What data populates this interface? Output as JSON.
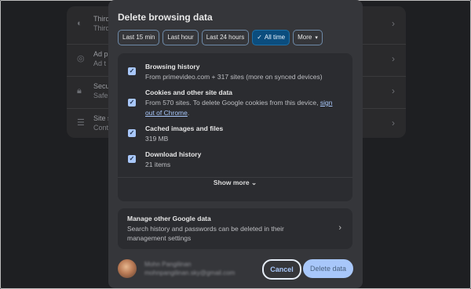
{
  "background": {
    "rows": [
      {
        "icon": "cookie-icon",
        "line1": "Third",
        "line2": "Third"
      },
      {
        "icon": "ad-icon",
        "line1": "Ad p",
        "line2": "Ad t"
      },
      {
        "icon": "lock-icon",
        "line1": "Secu",
        "line2": "Safe"
      },
      {
        "icon": "sliders-icon",
        "line1": "Site s",
        "line2": "Cont"
      }
    ]
  },
  "dialog": {
    "title": "Delete browsing data",
    "time_ranges": [
      "Last 15 min",
      "Last hour",
      "Last 24 hours",
      "All time",
      "More"
    ],
    "selected_range": "All time",
    "items": [
      {
        "title": "Browsing history",
        "desc": "From primevideo.com + 317 sites (more on synced devices)",
        "checked": true
      },
      {
        "title": "Cookies and other site data",
        "desc": "From 570 sites. To delete Google cookies from this device,",
        "link": "sign out of Chrome",
        "desc_end": ".",
        "checked": true
      },
      {
        "title": "Cached images and files",
        "desc": "319 MB",
        "checked": true
      },
      {
        "title": "Download history",
        "desc": "21 items",
        "checked": true
      }
    ],
    "show_more": "Show more",
    "manage": {
      "title": "Manage other Google data",
      "desc": "Search history and passwords can be deleted in their management settings"
    },
    "account": {
      "name": "Mohn Pangilinan",
      "email": "mohnpangilinan.sky@gmail.com"
    },
    "cancel_label": "Cancel",
    "delete_label": "Delete data"
  },
  "colors": {
    "accent": "#a8c7fa",
    "active_chip": "#0b4d7e",
    "dialog_bg": "#35363a",
    "card_bg": "#2b2c30"
  }
}
